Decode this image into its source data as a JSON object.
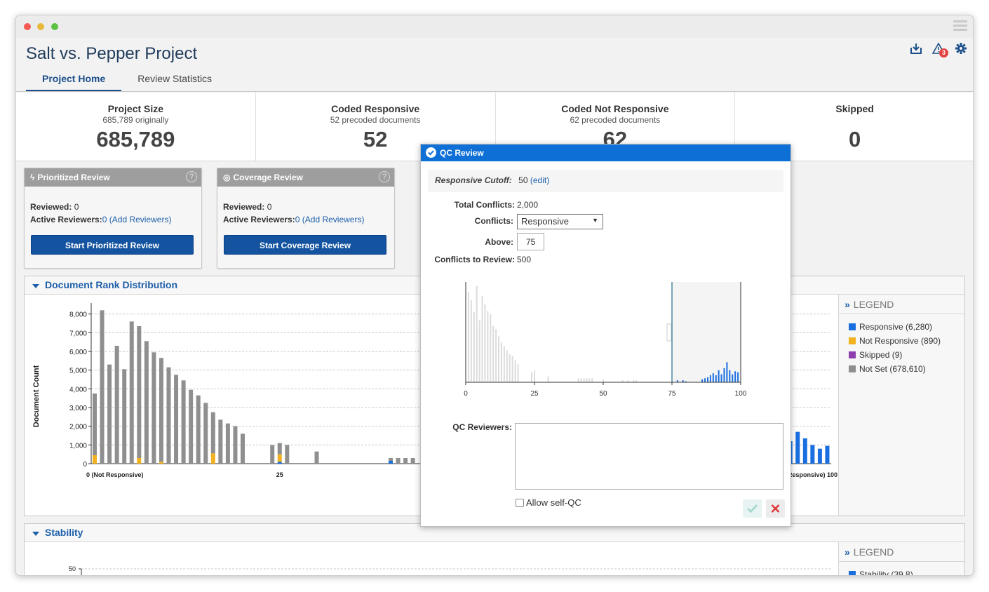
{
  "window": {
    "title": "Salt vs. Pepper Project",
    "alert_count": "3"
  },
  "tabs": [
    {
      "label": "Project Home"
    },
    {
      "label": "Review Statistics"
    }
  ],
  "stats": [
    {
      "title": "Project Size",
      "sub": "685,789 originally",
      "value": "685,789"
    },
    {
      "title": "Coded Responsive",
      "sub": "52 precoded documents",
      "value": "52"
    },
    {
      "title": "Coded Not Responsive",
      "sub": "62 precoded documents",
      "value": "62"
    },
    {
      "title": "Skipped",
      "sub": "",
      "value": "0"
    }
  ],
  "cards": [
    {
      "title": "Prioritized Review",
      "help": "?",
      "reviewed_label": "Reviewed:",
      "reviewed_value": "0",
      "reviewers_label": "Active Reviewers:",
      "reviewers_value": "0",
      "add_link": "(Add Reviewers)",
      "button": "Start Prioritized Review"
    },
    {
      "title": "Coverage Review",
      "help": "?",
      "reviewed_label": "Reviewed:",
      "reviewed_value": "0",
      "reviewers_label": "Active Reviewers:",
      "reviewers_value": "0",
      "add_link": "(Add Reviewers)",
      "button": "Start Coverage Review"
    }
  ],
  "rank_panel": {
    "title": "Document Rank Distribution",
    "legend_title": "LEGEND",
    "legend": [
      {
        "label": "Responsive (6,280)",
        "color": "#1a6fe0"
      },
      {
        "label": "Not Responsive (890)",
        "color": "#f0b21e"
      },
      {
        "label": "Skipped (9)",
        "color": "#8e3fae"
      },
      {
        "label": "Not Set (678,610)",
        "color": "#8f8f8f"
      }
    ]
  },
  "stability_panel": {
    "title": "Stability",
    "legend_title": "LEGEND",
    "legend": [
      {
        "label": "Stability (39.8)",
        "color": "#1a6fe0"
      }
    ]
  },
  "modal": {
    "title": "QC Review",
    "cutoff_label": "Responsive Cutoff:",
    "cutoff_value": "50",
    "cutoff_edit": "(edit)",
    "total_conflicts_label": "Total Conflicts:",
    "total_conflicts_value": "2,000",
    "conflicts_label": "Conflicts:",
    "conflicts_selected": "Responsive",
    "above_label": "Above:",
    "above_value": "75",
    "to_review_label": "Conflicts to Review:",
    "to_review_value": "500",
    "qc_reviewers_label": "QC Reviewers:",
    "allow_self_qc": "Allow self-QC"
  },
  "chart_data": [
    {
      "type": "bar",
      "name": "Document Rank Distribution",
      "ylabel": "Document Count",
      "xlabel": "",
      "ylim": [
        0,
        8400
      ],
      "yticks": [
        "0",
        "1,000",
        "2,000",
        "3,000",
        "4,000",
        "5,000",
        "6,000",
        "7,000",
        "8,000"
      ],
      "xtick_labels": [
        "0 (Not Responsive)",
        "25",
        "(Responsive) 100"
      ],
      "grid": true,
      "stacked": true,
      "series_colors": {
        "Responsive": "#1a6fe0",
        "Not Responsive": "#f0b21e",
        "Not Set": "#8f8f8f"
      },
      "bars": [
        {
          "x": 0,
          "not_set": 3300,
          "not_responsive": 450,
          "responsive": 0
        },
        {
          "x": 1,
          "not_set": 8200,
          "not_responsive": 0,
          "responsive": 0
        },
        {
          "x": 2,
          "not_set": 5300,
          "not_responsive": 0,
          "responsive": 0
        },
        {
          "x": 3,
          "not_set": 6300,
          "not_responsive": 0,
          "responsive": 0
        },
        {
          "x": 4,
          "not_set": 5050,
          "not_responsive": 0,
          "responsive": 0
        },
        {
          "x": 5,
          "not_set": 7600,
          "not_responsive": 0,
          "responsive": 0
        },
        {
          "x": 6,
          "not_set": 7050,
          "not_responsive": 300,
          "responsive": 0
        },
        {
          "x": 7,
          "not_set": 6550,
          "not_responsive": 0,
          "responsive": 0
        },
        {
          "x": 8,
          "not_set": 5950,
          "not_responsive": 0,
          "responsive": 0
        },
        {
          "x": 9,
          "not_set": 5550,
          "not_responsive": 100,
          "responsive": 0
        },
        {
          "x": 10,
          "not_set": 5150,
          "not_responsive": 0,
          "responsive": 0
        },
        {
          "x": 11,
          "not_set": 4750,
          "not_responsive": 0,
          "responsive": 0
        },
        {
          "x": 12,
          "not_set": 4450,
          "not_responsive": 0,
          "responsive": 0
        },
        {
          "x": 13,
          "not_set": 3950,
          "not_responsive": 0,
          "responsive": 0
        },
        {
          "x": 14,
          "not_set": 3650,
          "not_responsive": 0,
          "responsive": 0
        },
        {
          "x": 15,
          "not_set": 3250,
          "not_responsive": 0,
          "responsive": 0
        },
        {
          "x": 16,
          "not_set": 2200,
          "not_responsive": 550,
          "responsive": 0
        },
        {
          "x": 17,
          "not_set": 2350,
          "not_responsive": 0,
          "responsive": 0
        },
        {
          "x": 18,
          "not_set": 2150,
          "not_responsive": 0,
          "responsive": 0
        },
        {
          "x": 19,
          "not_set": 2000,
          "not_responsive": 0,
          "responsive": 0
        },
        {
          "x": 20,
          "not_set": 1600,
          "not_responsive": 0,
          "responsive": 0
        },
        {
          "x": 24,
          "not_set": 1000,
          "not_responsive": 0,
          "responsive": 0
        },
        {
          "x": 25,
          "not_set": 600,
          "not_responsive": 400,
          "responsive": 100
        },
        {
          "x": 26,
          "not_set": 1000,
          "not_responsive": 0,
          "responsive": 0
        },
        {
          "x": 30,
          "not_set": 650,
          "not_responsive": 0,
          "responsive": 0
        },
        {
          "x": 40,
          "not_set": 150,
          "not_responsive": 0,
          "responsive": 150
        },
        {
          "x": 41,
          "not_set": 300,
          "not_responsive": 0,
          "responsive": 0
        },
        {
          "x": 42,
          "not_set": 300,
          "not_responsive": 0,
          "responsive": 0
        },
        {
          "x": 43,
          "not_set": 300,
          "not_responsive": 0,
          "responsive": 0
        },
        {
          "x": 94,
          "not_set": 0,
          "not_responsive": 0,
          "responsive": 1200
        },
        {
          "x": 95,
          "not_set": 0,
          "not_responsive": 0,
          "responsive": 1700
        },
        {
          "x": 96,
          "not_set": 0,
          "not_responsive": 0,
          "responsive": 1350
        },
        {
          "x": 97,
          "not_set": 0,
          "not_responsive": 0,
          "responsive": 1000
        },
        {
          "x": 98,
          "not_set": 0,
          "not_responsive": 0,
          "responsive": 800
        },
        {
          "x": 99,
          "not_set": 0,
          "not_responsive": 0,
          "responsive": 950
        }
      ]
    },
    {
      "type": "bar",
      "name": "QC Review conflict distribution",
      "xlim": [
        0,
        100
      ],
      "xticks": [
        "0",
        "25",
        "50",
        "75",
        "100"
      ],
      "highlight_range": [
        75,
        100
      ],
      "series_colors": {
        "Responsive": "#1a6fe0",
        "Not Set": "#d9d9d9"
      },
      "faded_bars": [
        {
          "x": 1,
          "v": 0.9
        },
        {
          "x": 2,
          "v": 0.82
        },
        {
          "x": 3,
          "v": 0.7
        },
        {
          "x": 4,
          "v": 0.96
        },
        {
          "x": 5,
          "v": 0.62
        },
        {
          "x": 6,
          "v": 0.86
        },
        {
          "x": 7,
          "v": 0.78
        },
        {
          "x": 8,
          "v": 0.71
        },
        {
          "x": 9,
          "v": 0.68
        },
        {
          "x": 10,
          "v": 0.56
        },
        {
          "x": 11,
          "v": 0.53
        },
        {
          "x": 12,
          "v": 0.46
        },
        {
          "x": 13,
          "v": 0.4
        },
        {
          "x": 14,
          "v": 0.36
        },
        {
          "x": 15,
          "v": 0.32
        },
        {
          "x": 16,
          "v": 0.28
        },
        {
          "x": 17,
          "v": 0.26
        },
        {
          "x": 18,
          "v": 0.22
        },
        {
          "x": 19,
          "v": 0.18
        },
        {
          "x": 24,
          "v": 0.1
        },
        {
          "x": 25,
          "v": 0.12
        },
        {
          "x": 30,
          "v": 0.06
        },
        {
          "x": 41,
          "v": 0.04
        },
        {
          "x": 42,
          "v": 0.04
        },
        {
          "x": 43,
          "v": 0.04
        },
        {
          "x": 44,
          "v": 0.04
        },
        {
          "x": 45,
          "v": 0.04
        },
        {
          "x": 46,
          "v": 0.04
        },
        {
          "x": 50,
          "v": 0.03
        },
        {
          "x": 57,
          "v": 0.02
        },
        {
          "x": 59,
          "v": 0.02
        },
        {
          "x": 61,
          "v": 0.02
        },
        {
          "x": 62,
          "v": 0.02
        }
      ],
      "responsive_bars": [
        {
          "x": 77,
          "v": 0.02
        },
        {
          "x": 79,
          "v": 0.02
        },
        {
          "x": 80,
          "v": 0.01
        },
        {
          "x": 86,
          "v": 0.03
        },
        {
          "x": 87,
          "v": 0.04
        },
        {
          "x": 88,
          "v": 0.05
        },
        {
          "x": 89,
          "v": 0.07
        },
        {
          "x": 90,
          "v": 0.09
        },
        {
          "x": 91,
          "v": 0.07
        },
        {
          "x": 92,
          "v": 0.12
        },
        {
          "x": 93,
          "v": 0.08
        },
        {
          "x": 94,
          "v": 0.14
        },
        {
          "x": 95,
          "v": 0.2
        },
        {
          "x": 96,
          "v": 0.12
        },
        {
          "x": 97,
          "v": 0.08
        },
        {
          "x": 98,
          "v": 0.11
        },
        {
          "x": 99,
          "v": 0.1
        }
      ]
    },
    {
      "type": "line",
      "name": "Stability",
      "yticks": [
        "50"
      ],
      "grid": true,
      "series": [
        {
          "name": "Stability (39.8)",
          "values": []
        }
      ]
    }
  ]
}
